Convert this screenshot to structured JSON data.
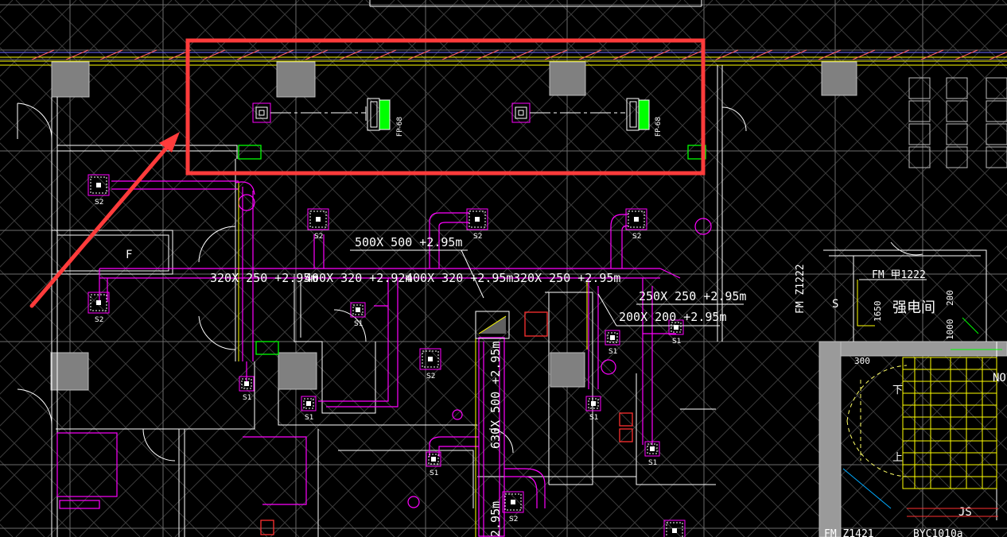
{
  "colors": {
    "background": "#000000",
    "grid": "#ffffff",
    "duct": "#ff00ff",
    "wall": "#ffffff",
    "column": "#808080",
    "highlight": "#ff3b3b",
    "unit_green": "#00ff00",
    "yellow": "#ffff00",
    "stair": "#ffff00"
  },
  "equipment": {
    "fan_coil_1_tag": "FP-68",
    "fan_coil_2_tag": "FP-68"
  },
  "diffusers": {
    "supply_tag": "S2",
    "exhaust_tag": "S1"
  },
  "duct_dimensions": {
    "d1": "500X 500 +2.95m",
    "d2": "320X 250 +2.95m",
    "d3": "400X 320 +2.92m",
    "d4": "400X 320 +2.95m",
    "d5": "320X 250 +2.95m",
    "d6": "250X 250 +2.95m",
    "d7": "200X 200 +2.95m",
    "d8": "630X 500 +2.95m",
    "d9": "2.95m"
  },
  "room_labels": {
    "door_tag_1": "FM 甲1222",
    "room_name": "强电间",
    "dim_1650": "1650",
    "dim_200": "200",
    "dim_1000": "1000",
    "dim_300": "300",
    "door_tag_2": "FM Z1222",
    "door_tag_3": "FM Z1421",
    "window_tag": "BYC1010a",
    "label_F": "F",
    "label_S": "S",
    "label_JS": "JS",
    "label_NO": "NO",
    "stair_down": "下",
    "stair_up": "上"
  }
}
